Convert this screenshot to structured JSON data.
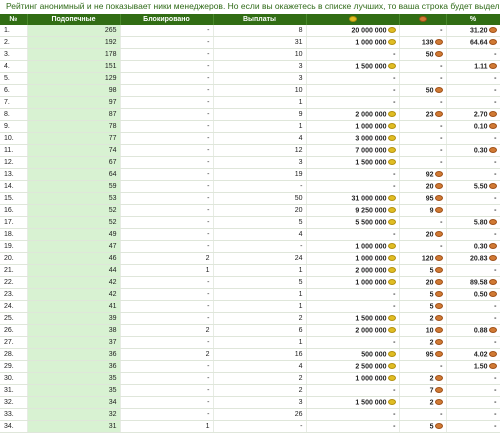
{
  "note": "Рейтинг анонимный и не показывает ники менеджеров. Но если вы окажетесь в списке лучших, то ваша строка будет выделена цветом.",
  "headers": {
    "num": "№",
    "wards": "Подопечные",
    "blocked": "Блокировано",
    "payouts": "Выплаты",
    "gold_icon": "gold-coin-icon",
    "copper_icon": "copper-coin-icon",
    "percent": "%"
  },
  "colors": {
    "header_bg": "#316d14",
    "wards_bg": "#d8f2d2",
    "note_text": "#2f6a18"
  },
  "rows": [
    {
      "n": "1.",
      "w": "265",
      "b": "-",
      "p": "8",
      "g": "20 000 000",
      "c": "-",
      "pct": "31.20"
    },
    {
      "n": "2.",
      "w": "192",
      "b": "-",
      "p": "31",
      "g": "1 000 000",
      "c": "139",
      "pct": "64.64"
    },
    {
      "n": "3.",
      "w": "178",
      "b": "-",
      "p": "10",
      "g": "-",
      "c": "50",
      "pct": "-"
    },
    {
      "n": "4.",
      "w": "151",
      "b": "-",
      "p": "3",
      "g": "1 500 000",
      "c": "-",
      "pct": "1.11"
    },
    {
      "n": "5.",
      "w": "129",
      "b": "-",
      "p": "3",
      "g": "-",
      "c": "-",
      "pct": "-"
    },
    {
      "n": "6.",
      "w": "98",
      "b": "-",
      "p": "10",
      "g": "-",
      "c": "50",
      "pct": "-"
    },
    {
      "n": "7.",
      "w": "97",
      "b": "-",
      "p": "1",
      "g": "-",
      "c": "-",
      "pct": "-"
    },
    {
      "n": "8.",
      "w": "87",
      "b": "-",
      "p": "9",
      "g": "2 000 000",
      "c": "23",
      "pct": "2.70"
    },
    {
      "n": "9.",
      "w": "78",
      "b": "-",
      "p": "1",
      "g": "1 000 000",
      "c": "-",
      "pct": "0.10"
    },
    {
      "n": "10.",
      "w": "77",
      "b": "-",
      "p": "4",
      "g": "3 000 000",
      "c": "-",
      "pct": "-"
    },
    {
      "n": "11.",
      "w": "74",
      "b": "-",
      "p": "12",
      "g": "7 000 000",
      "c": "-",
      "pct": "0.30"
    },
    {
      "n": "12.",
      "w": "67",
      "b": "-",
      "p": "3",
      "g": "1 500 000",
      "c": "-",
      "pct": "-"
    },
    {
      "n": "13.",
      "w": "64",
      "b": "-",
      "p": "19",
      "g": "-",
      "c": "92",
      "pct": "-"
    },
    {
      "n": "14.",
      "w": "59",
      "b": "-",
      "p": "-",
      "g": "-",
      "c": "20",
      "pct": "5.50"
    },
    {
      "n": "15.",
      "w": "53",
      "b": "-",
      "p": "50",
      "g": "31 000 000",
      "c": "95",
      "pct": "-"
    },
    {
      "n": "16.",
      "w": "52",
      "b": "-",
      "p": "20",
      "g": "9 250 000",
      "c": "9",
      "pct": "-"
    },
    {
      "n": "17.",
      "w": "52",
      "b": "-",
      "p": "5",
      "g": "5 500 000",
      "c": "-",
      "pct": "5.80"
    },
    {
      "n": "18.",
      "w": "49",
      "b": "-",
      "p": "4",
      "g": "-",
      "c": "20",
      "pct": "-"
    },
    {
      "n": "19.",
      "w": "47",
      "b": "-",
      "p": "-",
      "g": "1 000 000",
      "c": "-",
      "pct": "0.30"
    },
    {
      "n": "20.",
      "w": "46",
      "b": "2",
      "p": "24",
      "g": "1 000 000",
      "c": "120",
      "pct": "20.83"
    },
    {
      "n": "21.",
      "w": "44",
      "b": "1",
      "p": "1",
      "g": "2 000 000",
      "c": "5",
      "pct": "-"
    },
    {
      "n": "22.",
      "w": "42",
      "b": "-",
      "p": "5",
      "g": "1 000 000",
      "c": "20",
      "pct": "89.58"
    },
    {
      "n": "23.",
      "w": "42",
      "b": "-",
      "p": "1",
      "g": "-",
      "c": "5",
      "pct": "0.50"
    },
    {
      "n": "24.",
      "w": "41",
      "b": "-",
      "p": "1",
      "g": "-",
      "c": "5",
      "pct": "-"
    },
    {
      "n": "25.",
      "w": "39",
      "b": "-",
      "p": "2",
      "g": "1 500 000",
      "c": "2",
      "pct": "-"
    },
    {
      "n": "26.",
      "w": "38",
      "b": "2",
      "p": "6",
      "g": "2 000 000",
      "c": "10",
      "pct": "0.88"
    },
    {
      "n": "27.",
      "w": "37",
      "b": "-",
      "p": "1",
      "g": "-",
      "c": "2",
      "pct": "-"
    },
    {
      "n": "28.",
      "w": "36",
      "b": "2",
      "p": "16",
      "g": "500 000",
      "c": "95",
      "pct": "4.02"
    },
    {
      "n": "29.",
      "w": "36",
      "b": "-",
      "p": "4",
      "g": "2 500 000",
      "c": "-",
      "pct": "1.50"
    },
    {
      "n": "30.",
      "w": "35",
      "b": "-",
      "p": "2",
      "g": "1 000 000",
      "c": "2",
      "pct": "-"
    },
    {
      "n": "31.",
      "w": "35",
      "b": "-",
      "p": "2",
      "g": "-",
      "c": "7",
      "pct": "-"
    },
    {
      "n": "32.",
      "w": "34",
      "b": "-",
      "p": "3",
      "g": "1 500 000",
      "c": "2",
      "pct": "-"
    },
    {
      "n": "33.",
      "w": "32",
      "b": "-",
      "p": "26",
      "g": "-",
      "c": "-",
      "pct": "-"
    },
    {
      "n": "34.",
      "w": "31",
      "b": "1",
      "p": "-",
      "g": "-",
      "c": "5",
      "pct": "-"
    }
  ]
}
